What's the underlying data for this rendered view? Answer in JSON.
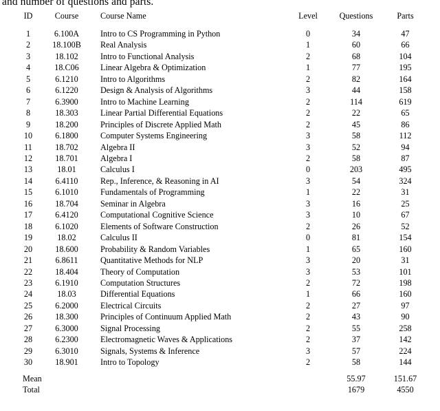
{
  "caption": {
    "text": "and number of questions and parts."
  },
  "table": {
    "columns": [
      {
        "key": "id",
        "label": "ID"
      },
      {
        "key": "course",
        "label": "Course"
      },
      {
        "key": "name",
        "label": "Course Name"
      },
      {
        "key": "level",
        "label": "Level"
      },
      {
        "key": "questions",
        "label": "Questions"
      },
      {
        "key": "parts",
        "label": "Parts"
      }
    ],
    "rows": [
      {
        "id": "1",
        "course": "6.100A",
        "name": "Intro to CS Programming in Python",
        "level": "0",
        "questions": "34",
        "parts": "47"
      },
      {
        "id": "2",
        "course": "18.100B",
        "name": "Real Analysis",
        "level": "1",
        "questions": "60",
        "parts": "66"
      },
      {
        "id": "3",
        "course": "18.102",
        "name": "Intro to Functional Analysis",
        "level": "2",
        "questions": "68",
        "parts": "104"
      },
      {
        "id": "4",
        "course": "18.C06",
        "name": "Linear Algebra & Optimization",
        "level": "1",
        "questions": "77",
        "parts": "195"
      },
      {
        "id": "5",
        "course": "6.1210",
        "name": "Intro to Algorithms",
        "level": "2",
        "questions": "82",
        "parts": "164"
      },
      {
        "id": "6",
        "course": "6.1220",
        "name": "Design & Analysis of Algorithms",
        "level": "3",
        "questions": "44",
        "parts": "158"
      },
      {
        "id": "7",
        "course": "6.3900",
        "name": "Intro to Machine Learning",
        "level": "2",
        "questions": "114",
        "parts": "619"
      },
      {
        "id": "8",
        "course": "18.303",
        "name": "Linear Partial Differential Equations",
        "level": "2",
        "questions": "22",
        "parts": "65"
      },
      {
        "id": "9",
        "course": "18.200",
        "name": "Principles of Discrete Applied Math",
        "level": "2",
        "questions": "45",
        "parts": "86"
      },
      {
        "id": "10",
        "course": "6.1800",
        "name": "Computer Systems Engineering",
        "level": "3",
        "questions": "58",
        "parts": "112"
      },
      {
        "id": "11",
        "course": "18.702",
        "name": "Algebra II",
        "level": "3",
        "questions": "52",
        "parts": "94"
      },
      {
        "id": "12",
        "course": "18.701",
        "name": "Algebra I",
        "level": "2",
        "questions": "58",
        "parts": "87"
      },
      {
        "id": "13",
        "course": "18.01",
        "name": "Calculus I",
        "level": "0",
        "questions": "203",
        "parts": "495"
      },
      {
        "id": "14",
        "course": "6.4110",
        "name": "Rep., Inference, & Reasoning in AI",
        "level": "3",
        "questions": "54",
        "parts": "324"
      },
      {
        "id": "15",
        "course": "6.1010",
        "name": "Fundamentals of Programming",
        "level": "1",
        "questions": "22",
        "parts": "31"
      },
      {
        "id": "16",
        "course": "18.704",
        "name": "Seminar in Algebra",
        "level": "3",
        "questions": "16",
        "parts": "25"
      },
      {
        "id": "17",
        "course": "6.4120",
        "name": "Computational Cognitive Science",
        "level": "3",
        "questions": "10",
        "parts": "67"
      },
      {
        "id": "18",
        "course": "6.1020",
        "name": "Elements of Software Construction",
        "level": "2",
        "questions": "26",
        "parts": "52"
      },
      {
        "id": "19",
        "course": "18.02",
        "name": "Calculus II",
        "level": "0",
        "questions": "81",
        "parts": "154"
      },
      {
        "id": "20",
        "course": "18.600",
        "name": "Probability & Random Variables",
        "level": "1",
        "questions": "65",
        "parts": "160"
      },
      {
        "id": "21",
        "course": "6.8611",
        "name": "Quantitative Methods for NLP",
        "level": "3",
        "questions": "20",
        "parts": "31"
      },
      {
        "id": "22",
        "course": "18.404",
        "name": "Theory of Computation",
        "level": "3",
        "questions": "53",
        "parts": "101"
      },
      {
        "id": "23",
        "course": "6.1910",
        "name": "Computation Structures",
        "level": "2",
        "questions": "72",
        "parts": "198"
      },
      {
        "id": "24",
        "course": "18.03",
        "name": "Differential Equations",
        "level": "1",
        "questions": "66",
        "parts": "160"
      },
      {
        "id": "25",
        "course": "6.2000",
        "name": "Electrical Circuits",
        "level": "2",
        "questions": "27",
        "parts": "97"
      },
      {
        "id": "26",
        "course": "18.300",
        "name": "Principles of Continuum Applied Math",
        "level": "2",
        "questions": "43",
        "parts": "90"
      },
      {
        "id": "27",
        "course": "6.3000",
        "name": "Signal Processing",
        "level": "2",
        "questions": "55",
        "parts": "258"
      },
      {
        "id": "28",
        "course": "6.2300",
        "name": "Electromagnetic Waves & Applications",
        "level": "2",
        "questions": "37",
        "parts": "142"
      },
      {
        "id": "29",
        "course": "6.3010",
        "name": "Signals, Systems & Inference",
        "level": "3",
        "questions": "57",
        "parts": "224"
      },
      {
        "id": "30",
        "course": "18.901",
        "name": "Intro to Topology",
        "level": "2",
        "questions": "58",
        "parts": "144"
      }
    ],
    "summary": [
      {
        "label": "Mean",
        "course": "",
        "name": "",
        "level": "",
        "questions": "55.97",
        "parts": "151.67"
      },
      {
        "label": "Total",
        "course": "",
        "name": "",
        "level": "",
        "questions": "1679",
        "parts": "4550"
      }
    ]
  }
}
